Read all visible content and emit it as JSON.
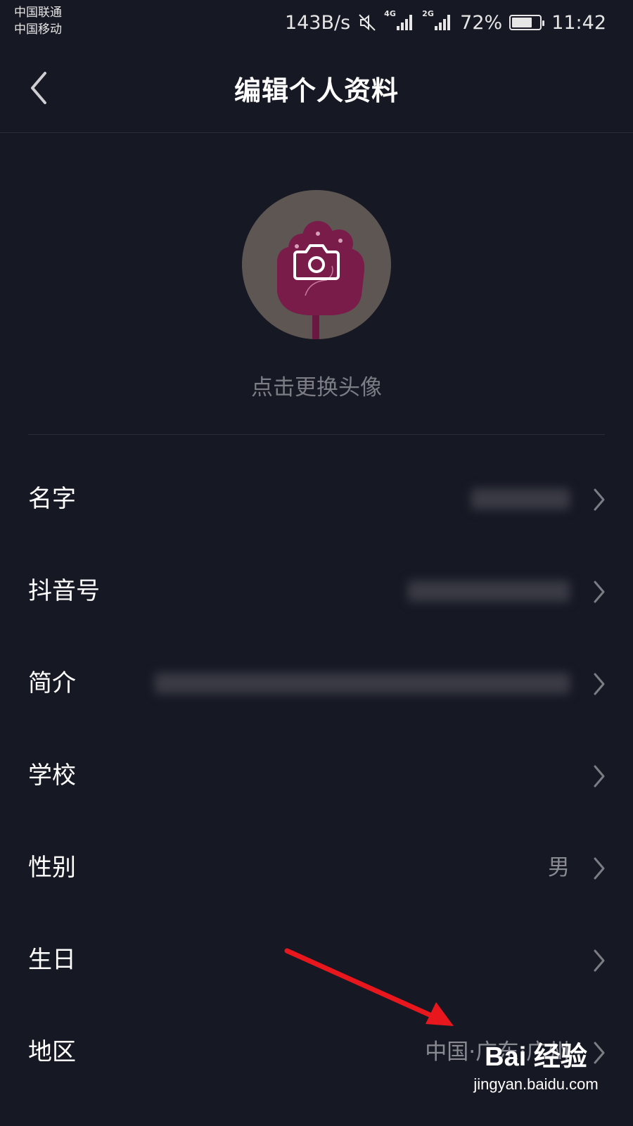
{
  "status_bar": {
    "carrier_1": "中国联通",
    "carrier_2": "中国移动",
    "net_speed": "143B/s",
    "network_1": "4G",
    "network_2": "2G",
    "battery_text": "72%",
    "battery_level": 0.72,
    "time": "11:42",
    "icons": [
      "mute-icon",
      "signal-4g-icon",
      "signal-2g-icon",
      "battery-icon"
    ]
  },
  "header": {
    "title": "编辑个人资料",
    "back_icon": "chevron-left-icon"
  },
  "avatar": {
    "overlay_icon": "camera-icon",
    "change_label": "点击更换头像"
  },
  "rows": [
    {
      "label": "名字",
      "value": "",
      "value_blurred": true
    },
    {
      "label": "抖音号",
      "value": "",
      "value_blurred": true
    },
    {
      "label": "简介",
      "value": "",
      "value_blurred": true
    },
    {
      "label": "学校",
      "value": ""
    },
    {
      "label": "性别",
      "value": "男"
    },
    {
      "label": "生日",
      "value": ""
    },
    {
      "label": "地区",
      "value": "中国·广东·广州"
    }
  ],
  "watermark": {
    "brand": "Bai 经验",
    "url": "jingyan.baidu.com"
  },
  "colors": {
    "background": "#161823",
    "annotation_arrow": "#e8171d",
    "avatar_bg": "#5e5653",
    "avatar_flower": "#7a1c4a"
  }
}
